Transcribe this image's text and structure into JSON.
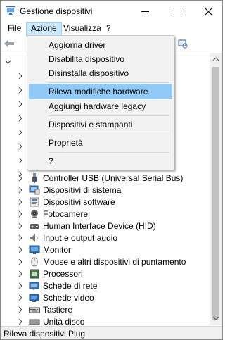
{
  "window": {
    "title": "Gestione dispositivi"
  },
  "menubar": {
    "items": [
      "File",
      "Azione",
      "Visualizza",
      "?"
    ]
  },
  "action_menu": {
    "items": [
      "Aggiorna driver",
      "Disabilita dispositivo",
      "Disinstalla dispositivo",
      "Rileva modifiche hardware",
      "Aggiungi hardware legacy",
      "Dispositivi e stampanti",
      "Proprietà",
      "?"
    ],
    "highlighted": "Rileva modifiche hardware"
  },
  "tree": {
    "categories": [
      {
        "label": "Controller USB (Universal Serial Bus)",
        "icon": "usb-icon"
      },
      {
        "label": "Dispositivi di sistema",
        "icon": "system-device-icon"
      },
      {
        "label": "Dispositivi software",
        "icon": "software-device-icon"
      },
      {
        "label": "Fotocamere",
        "icon": "camera-icon"
      },
      {
        "label": "Human Interface Device (HID)",
        "icon": "hid-icon"
      },
      {
        "label": "Input e output audio",
        "icon": "speaker-icon"
      },
      {
        "label": "Monitor",
        "icon": "monitor-icon"
      },
      {
        "label": "Mouse e altri dispositivi di puntamento",
        "icon": "mouse-icon"
      },
      {
        "label": "Processori",
        "icon": "processor-icon"
      },
      {
        "label": "Schede di rete",
        "icon": "network-adapter-icon"
      },
      {
        "label": "Schede video",
        "icon": "display-adapter-icon"
      },
      {
        "label": "Tastiere",
        "icon": "keyboard-icon"
      },
      {
        "label": "Unità disco",
        "icon": "disk-drive-icon"
      }
    ]
  },
  "statusbar": {
    "text": "Rileva dispositivi Plug"
  },
  "colors": {
    "menu_highlight": "#91c9f7",
    "active_menu": "#cce8ff"
  }
}
